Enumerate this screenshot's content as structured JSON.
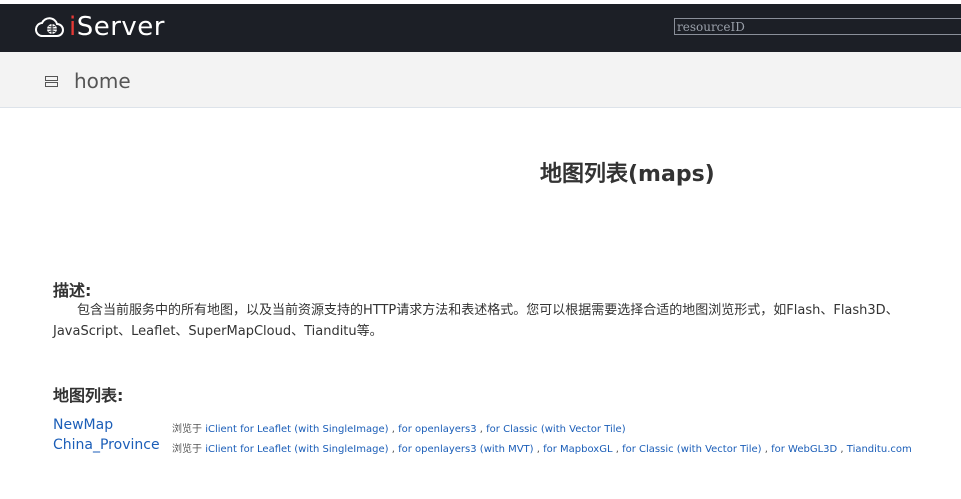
{
  "header": {
    "logo_text_i": "i",
    "logo_text_rest": "Server",
    "search": {
      "placeholder": "resourceID"
    }
  },
  "breadcrumb": {
    "home_label": "home"
  },
  "page": {
    "title": "地图列表(maps)",
    "description_heading": "描述:",
    "description_text": "包含当前服务中的所有地图，以及当前资源支持的HTTP请求方法和表述格式。您可以根据需要选择合适的地图浏览形式，如Flash、Flash3D、JavaScript、Leaflet、SuperMapCloud、Tianditu等。",
    "list_heading": "地图列表:",
    "browse_prefix": "浏览于",
    "maps": [
      {
        "name": "NewMap",
        "links": [
          "iClient for Leaflet (with SingleImage)",
          "for openlayers3",
          "for Classic (with Vector Tile)"
        ]
      },
      {
        "name": "China_Province",
        "links": [
          "iClient for Leaflet (with SingleImage)",
          "for openlayers3 (with MVT)",
          "for MapboxGL",
          "for Classic (with Vector Tile)",
          "for WebGL3D",
          "Tianditu.com"
        ]
      }
    ]
  },
  "colors": {
    "topbar": "#1c1f26",
    "link": "#1b5eb8",
    "logo_accent": "#e53935"
  }
}
